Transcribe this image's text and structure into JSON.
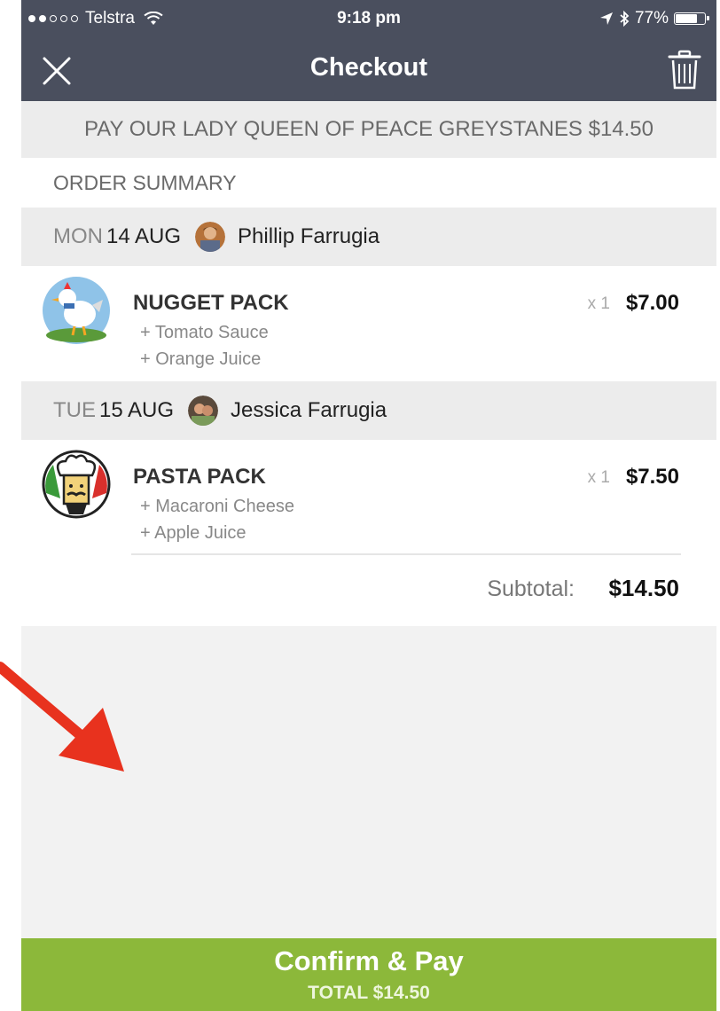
{
  "status_bar": {
    "carrier": "Telstra",
    "time": "9:18 pm",
    "battery": "77%",
    "battery_level": 0.77,
    "signal_dots_filled": 2,
    "signal_dots_total": 5
  },
  "nav": {
    "title": "Checkout",
    "close_icon": "close-icon",
    "trash_icon": "trash-icon"
  },
  "pay_banner": "PAY OUR LADY QUEEN OF PEACE GREYSTANES $14.50",
  "order_summary_label": "ORDER SUMMARY",
  "orders": [
    {
      "day": "MON",
      "date": "14 AUG",
      "name": "Phillip Farrugia",
      "item": {
        "name": "NUGGET PACK",
        "icon": "chicken-icon",
        "qty": "x 1",
        "price": "$7.00",
        "options": [
          "+ Tomato Sauce",
          "+ Orange Juice"
        ]
      }
    },
    {
      "day": "TUE",
      "date": "15 AUG",
      "name": "Jessica Farrugia",
      "item": {
        "name": "PASTA PACK",
        "icon": "chef-icon",
        "qty": "x 1",
        "price": "$7.50",
        "options": [
          "+ Macaroni Cheese",
          "+ Apple Juice"
        ]
      }
    }
  ],
  "subtotal": {
    "label": "Subtotal:",
    "value": "$14.50"
  },
  "confirm": {
    "label": "Confirm & Pay",
    "total": "TOTAL $14.50"
  },
  "colors": {
    "nav_bg": "#4a4f5e",
    "confirm_green": "#8cb83a",
    "arrow_red": "#e8321e"
  }
}
